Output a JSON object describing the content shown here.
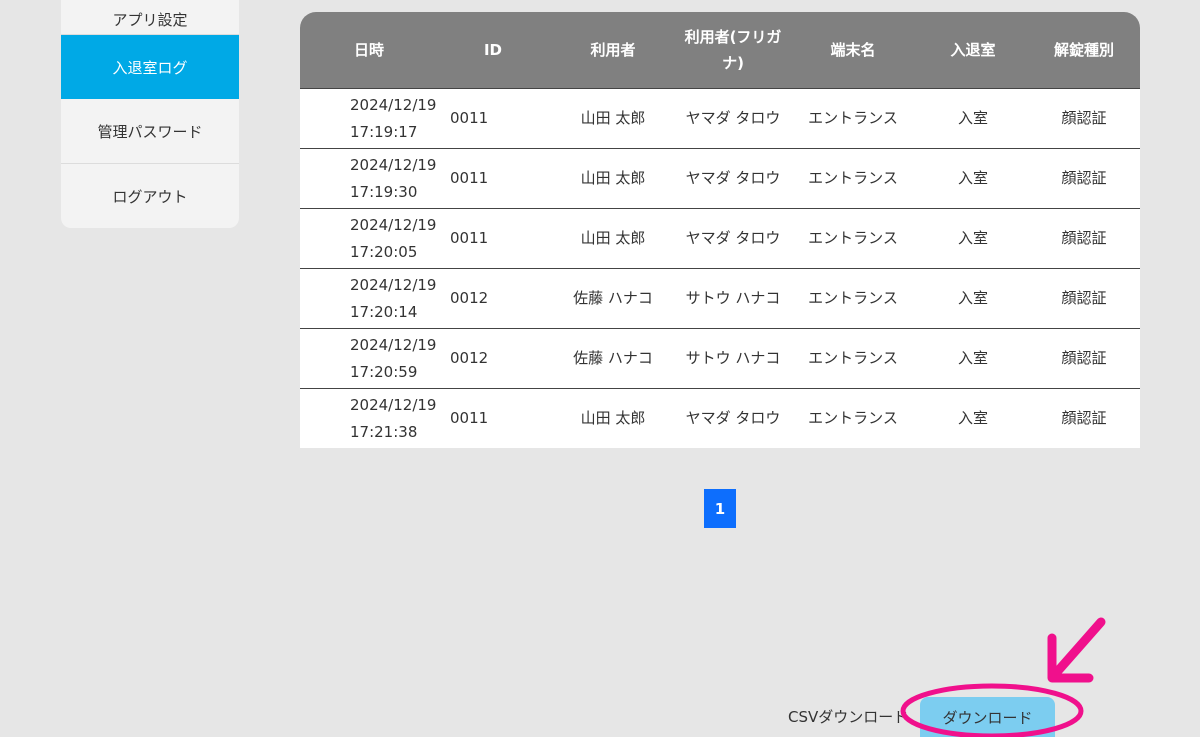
{
  "sidebar": {
    "items": [
      {
        "label": "アプリ設定"
      },
      {
        "label": "入退室ログ",
        "active": true
      },
      {
        "label": "管理パスワード"
      },
      {
        "label": "ログアウト"
      }
    ]
  },
  "table": {
    "headers": [
      "日時",
      "ID",
      "利用者",
      "利用者(フリガナ)",
      "端末名",
      "入退室",
      "解錠種別"
    ],
    "rows": [
      {
        "date": "2024/12/19",
        "time": "17:19:17",
        "id": "0011",
        "user": "山田 太郎",
        "kana": "ヤマダ タロウ",
        "device": "エントランス",
        "inout": "入室",
        "unlock": "顔認証"
      },
      {
        "date": "2024/12/19",
        "time": "17:19:30",
        "id": "0011",
        "user": "山田 太郎",
        "kana": "ヤマダ タロウ",
        "device": "エントランス",
        "inout": "入室",
        "unlock": "顔認証"
      },
      {
        "date": "2024/12/19",
        "time": "17:20:05",
        "id": "0011",
        "user": "山田 太郎",
        "kana": "ヤマダ タロウ",
        "device": "エントランス",
        "inout": "入室",
        "unlock": "顔認証"
      },
      {
        "date": "2024/12/19",
        "time": "17:20:14",
        "id": "0012",
        "user": "佐藤 ハナコ",
        "kana": "サトウ ハナコ",
        "device": "エントランス",
        "inout": "入室",
        "unlock": "顔認証"
      },
      {
        "date": "2024/12/19",
        "time": "17:20:59",
        "id": "0012",
        "user": "佐藤 ハナコ",
        "kana": "サトウ ハナコ",
        "device": "エントランス",
        "inout": "入室",
        "unlock": "顔認証"
      },
      {
        "date": "2024/12/19",
        "time": "17:21:38",
        "id": "0011",
        "user": "山田 太郎",
        "kana": "ヤマダ タロウ",
        "device": "エントランス",
        "inout": "入室",
        "unlock": "顔認証"
      }
    ]
  },
  "pagination": {
    "current": "1"
  },
  "csv": {
    "label": "CSVダウンロード",
    "button": "ダウンロード"
  },
  "colors": {
    "accent": "#00a9e6",
    "header": "#808080",
    "page": "#0d6efd",
    "button": "#7ccdf0",
    "annotation": "#f0108c"
  }
}
